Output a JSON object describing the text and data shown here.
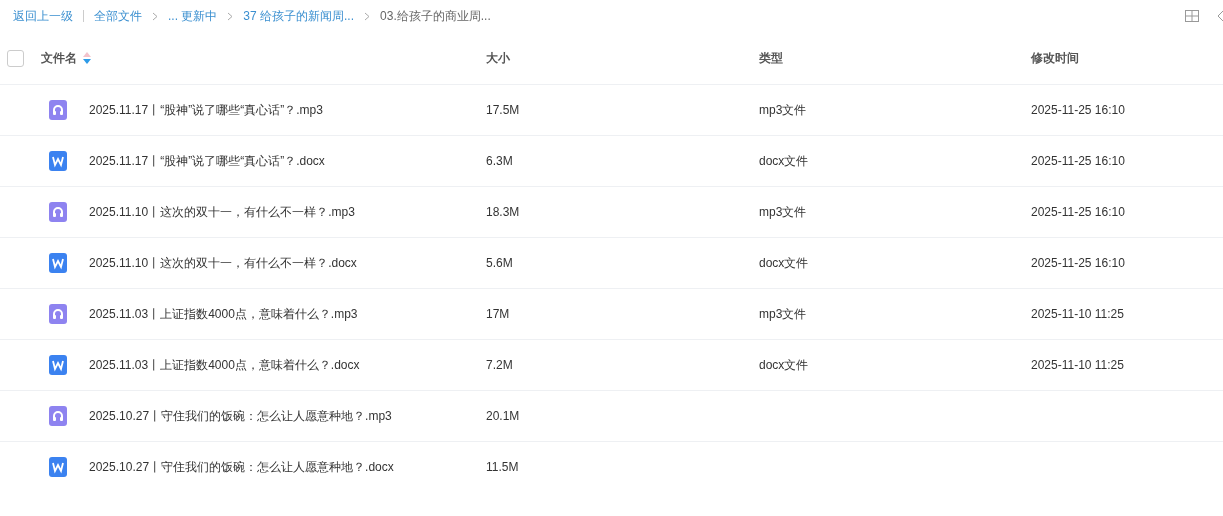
{
  "breadcrumb": {
    "back": "返回上一级",
    "items": [
      {
        "label": "全部文件",
        "current": false
      },
      {
        "label": "... 更新中",
        "current": false
      },
      {
        "label": "37 给孩子的新闻周...",
        "current": false
      },
      {
        "label": "03.给孩子的商业周...",
        "current": true
      }
    ]
  },
  "table": {
    "select_all": {
      "checked": false
    },
    "columns": [
      {
        "label": "文件名",
        "sorted": true
      },
      {
        "label": "大小",
        "sorted": false
      },
      {
        "label": "类型",
        "sorted": false
      },
      {
        "label": "修改时间",
        "sorted": false
      }
    ],
    "rows": [
      {
        "kind": "audio",
        "name": "2025.11.17丨“股神”说了哪些“真心话”？.mp3",
        "size": "17.5M",
        "type": "mp3文件",
        "modified": "2025-11-25 16:10"
      },
      {
        "kind": "word",
        "name": "2025.11.17丨“股神”说了哪些“真心话”？.docx",
        "size": "6.3M",
        "type": "docx文件",
        "modified": "2025-11-25 16:10"
      },
      {
        "kind": "audio",
        "name": "2025.11.10丨这次的双十一，有什么不一样？.mp3",
        "size": "18.3M",
        "type": "mp3文件",
        "modified": "2025-11-25 16:10"
      },
      {
        "kind": "word",
        "name": "2025.11.10丨这次的双十一，有什么不一样？.docx",
        "size": "5.6M",
        "type": "docx文件",
        "modified": "2025-11-25 16:10"
      },
      {
        "kind": "audio",
        "name": "2025.11.03丨上证指数4000点，意味着什么？.mp3",
        "size": "17M",
        "type": "mp3文件",
        "modified": "2025-11-10 11:25"
      },
      {
        "kind": "word",
        "name": "2025.11.03丨上证指数4000点，意味着什么？.docx",
        "size": "7.2M",
        "type": "docx文件",
        "modified": "2025-11-10 11:25"
      },
      {
        "kind": "audio",
        "name": "2025.10.27丨守住我们的饭碗：怎么让人愿意种地？.mp3",
        "size": "20.1M"
      },
      {
        "kind": "word",
        "name": "2025.10.27丨守住我们的饭碗：怎么让人愿意种地？.docx",
        "size": "11.5M"
      }
    ]
  }
}
